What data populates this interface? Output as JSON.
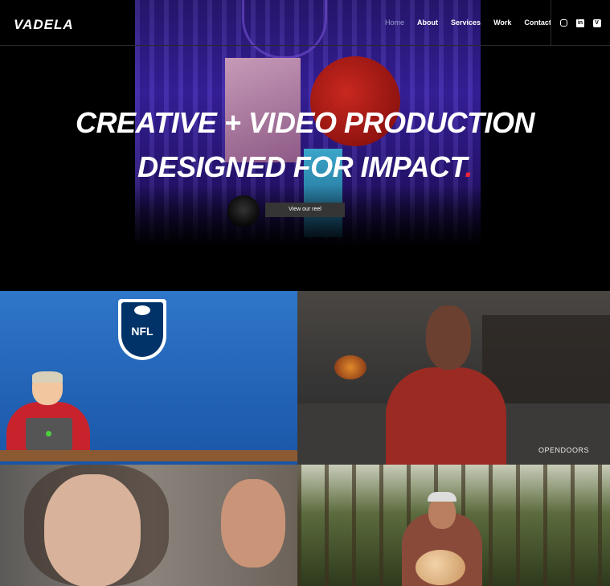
{
  "brand": {
    "logo": "VADELA"
  },
  "nav": {
    "items": [
      {
        "label": "Home",
        "active": true
      },
      {
        "label": "About",
        "active": false
      },
      {
        "label": "Services",
        "active": false
      },
      {
        "label": "Work",
        "active": false
      },
      {
        "label": "Contact",
        "active": false
      }
    ]
  },
  "social": {
    "icons": [
      "instagram-icon",
      "linkedin-icon",
      "vimeo-icon"
    ],
    "linkedin_glyph": "in",
    "vimeo_glyph": "V"
  },
  "hero": {
    "line1": "CREATIVE + VIDEO PRODUCTION",
    "line2": "DESIGNED FOR IMPACT",
    "dot": ".",
    "button": "View our reel",
    "accent_color": "#f0243a"
  },
  "tiles": {
    "nfl_logo": "NFL",
    "opendoors_label": "OPENDOORS"
  }
}
